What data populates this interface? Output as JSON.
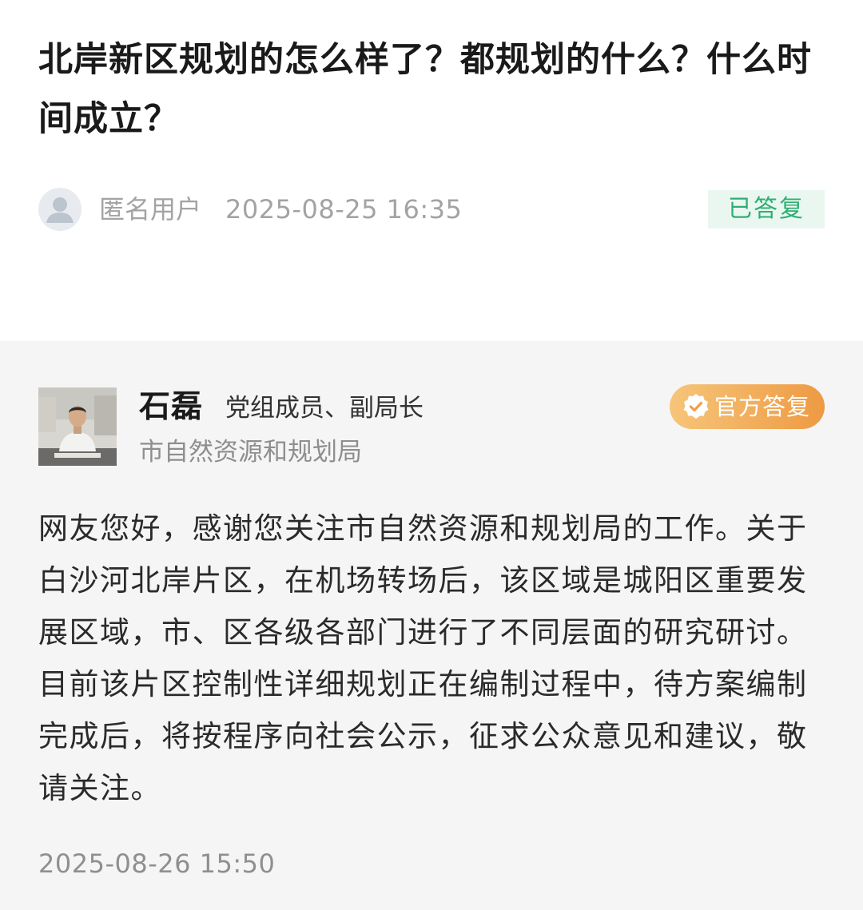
{
  "question": {
    "title": "北岸新区规划的怎么样了？都规划的什么？什么时间成立？",
    "author": "匿名用户",
    "timestamp": "2025-08-25 16:35",
    "status_label": "已答复",
    "avatar_icon": "user-silhouette-icon",
    "status_color": "#2fae72"
  },
  "answer": {
    "responder_name": "石磊",
    "responder_title": "党组成员、副局长",
    "department": "市自然资源和规划局",
    "badge_label": "官方答复",
    "badge_icon": "verified-badge-icon",
    "badge_color": "#ee9a43",
    "body": "网友您好，感谢您关注市自然资源和规划局的工作。关于白沙河北岸片区，在机场转场后，该区域是城阳区重要发展区域，市、区各级各部门进行了不同层面的研究研讨。目前该片区控制性详细规划正在编制过程中，待方案编制完成后，将按程序向社会公示，征求公众意见和建议，敬请关注。",
    "timestamp": "2025-08-26 15:50"
  }
}
